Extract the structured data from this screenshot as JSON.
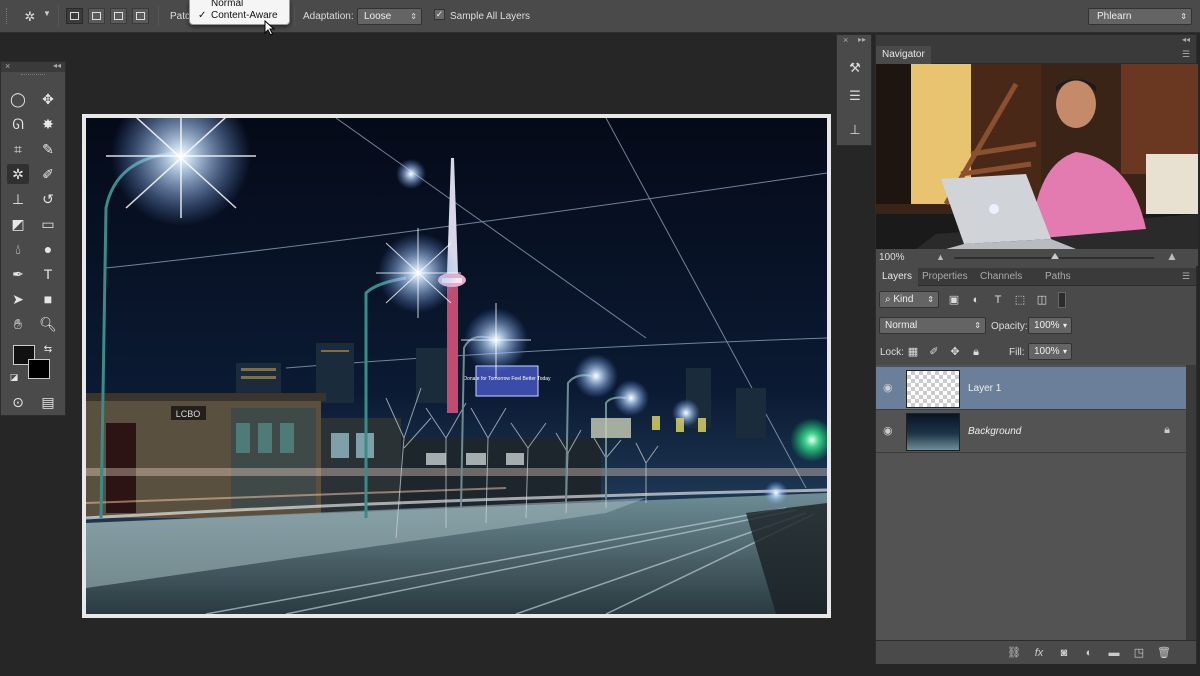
{
  "options_bar": {
    "patch_label": "Patch",
    "patch_menu": {
      "items": [
        "Normal",
        "Content-Aware"
      ],
      "selected": "Content-Aware",
      "check": "✓"
    },
    "adaptation_label": "Adaptation:",
    "adaptation_value": "Loose",
    "sample_all_layers_label": "Sample All Layers",
    "sample_all_layers_checked": true,
    "workspace": "Phlearn"
  },
  "navigator": {
    "tab": "Navigator",
    "zoom": "100%"
  },
  "layers_panel": {
    "tabs": [
      "Layers",
      "Properties",
      "Channels",
      "Paths"
    ],
    "active_tab": "Layers",
    "filter_kind": "Kind",
    "blend_mode": "Normal",
    "opacity_label": "Opacity:",
    "opacity": "100%",
    "lock_label": "Lock:",
    "fill_label": "Fill:",
    "fill": "100%",
    "layers": [
      {
        "name": "Layer 1",
        "selected": true,
        "italic": false,
        "locked": false
      },
      {
        "name": "Background",
        "selected": false,
        "italic": true,
        "locked": true
      }
    ]
  },
  "photo": {
    "billboard_text": "Donate for Tomorrow Feel Better Today",
    "storefront_sign": "LCBO"
  },
  "colors": {
    "selected_layer": "#6c7f9a",
    "panel_bg": "#4a4a4a",
    "app_bg": "#262626"
  }
}
